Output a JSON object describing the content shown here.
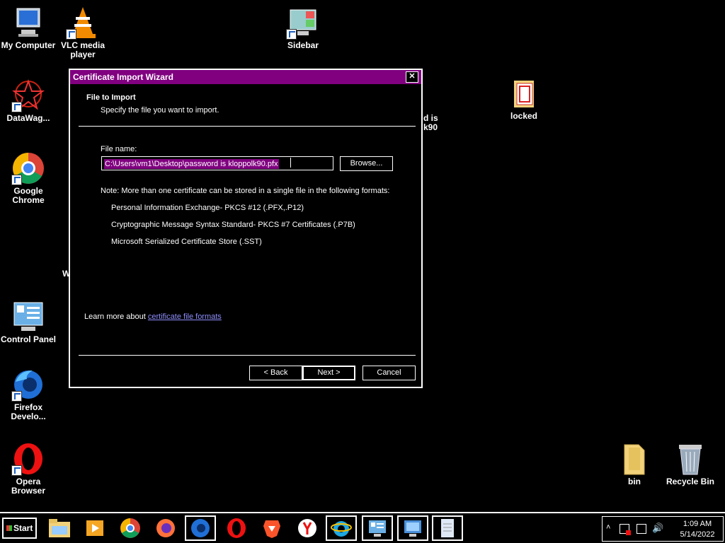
{
  "desktop": {
    "icons": [
      {
        "label": "My Computer"
      },
      {
        "label": "VLC media player"
      },
      {
        "label": "Sidebar"
      },
      {
        "label": "DataWag..."
      },
      {
        "label": "locked"
      },
      {
        "label": "Google Chrome"
      },
      {
        "label": "Control Panel"
      },
      {
        "label": "Firefox Develo..."
      },
      {
        "label": "Opera Browser"
      },
      {
        "label": "bin"
      },
      {
        "label": "Recycle Bin"
      }
    ],
    "partial_labels": [
      "d is",
      "k90",
      "W"
    ]
  },
  "dialog": {
    "title": "Certificate Import Wizard",
    "close_label": "✕",
    "section_title": "File to Import",
    "section_subtitle": "Specify the file you want to import.",
    "file_name_label": "File name:",
    "file_name_value": "C:\\Users\\vm1\\Desktop\\password is kloppolk90.pfx",
    "browse_label": "Browse...",
    "note": "Note:  More than one certificate can be stored in a single file in the following formats:",
    "formats": [
      "Personal Information Exchange- PKCS #12 (.PFX,.P12)",
      "Cryptographic Message Syntax Standard- PKCS #7 Certificates (.P7B)",
      "Microsoft Serialized Certificate Store (.SST)"
    ],
    "learn_more_prefix": "Learn more about ",
    "learn_more_link": "certificate file formats",
    "back_label": "< Back",
    "next_label": "Next >",
    "cancel_label": "Cancel"
  },
  "taskbar": {
    "start_label": "Start",
    "items": [
      "file-explorer",
      "media-center",
      "chrome",
      "firefox",
      "firefox-developer",
      "opera",
      "brave",
      "yandex",
      "internet-explorer",
      "control-panel",
      "remote-desktop",
      "notepad"
    ],
    "clock_time": "1:09 AM",
    "clock_date": "5/14/2022"
  },
  "colors": {
    "title_bar": "#800080",
    "selection": "#800080",
    "link": "#8f8fff"
  }
}
